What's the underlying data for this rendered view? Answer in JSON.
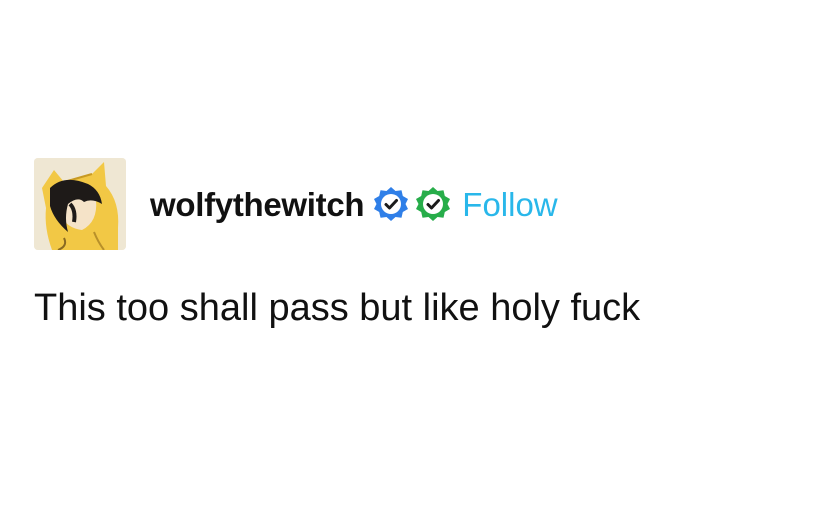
{
  "post": {
    "author": {
      "username": "wolfythewitch",
      "avatar_icon": "hooded-character-avatar",
      "badges": [
        {
          "icon": "verified-check-badge-icon",
          "color": "#2f7fe8"
        },
        {
          "icon": "verified-check-badge-icon",
          "color": "#27ad4a"
        }
      ],
      "follow_label": "Follow",
      "follow_color": "#29b7ea"
    },
    "text": "This too shall pass but like holy fuck"
  }
}
